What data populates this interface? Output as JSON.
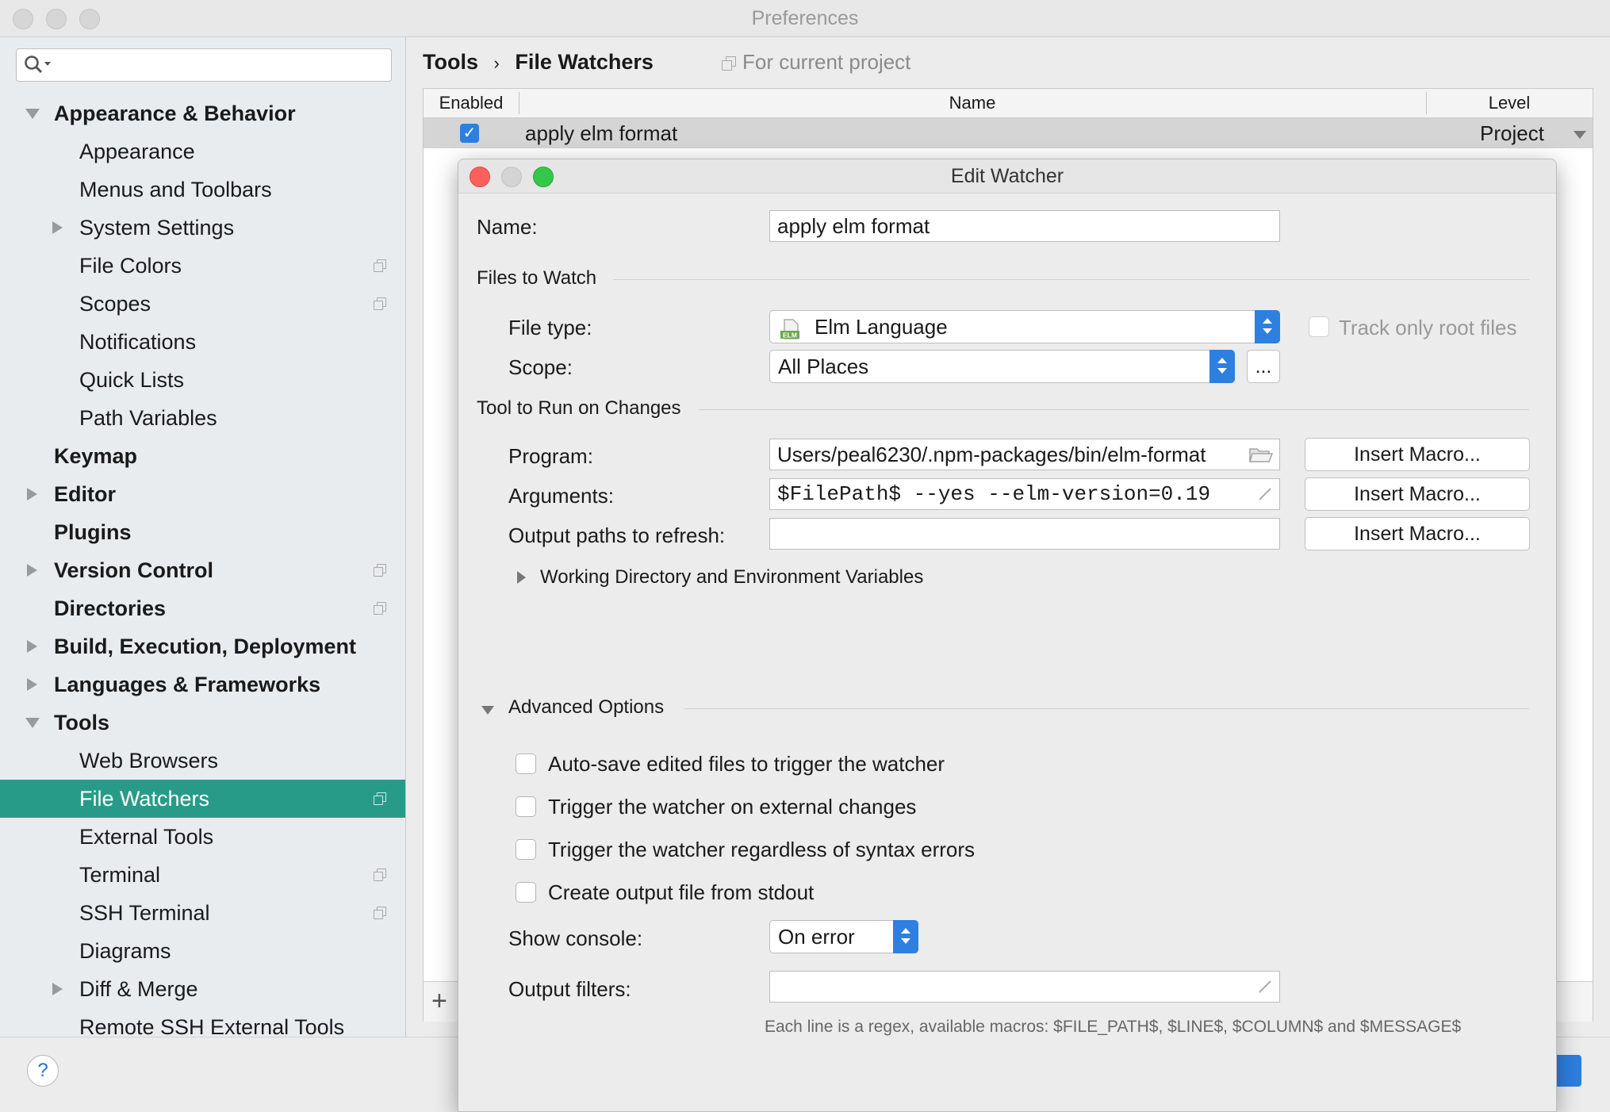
{
  "preferences": {
    "window_title": "Preferences",
    "breadcrumb": {
      "parent": "Tools",
      "separator": "›",
      "current": "File Watchers"
    },
    "scope_note": "For current project"
  },
  "sidebar": {
    "search_placeholder": "",
    "items": [
      {
        "label": "Appearance & Behavior",
        "level": 0,
        "bold": true,
        "expander": "expanded"
      },
      {
        "label": "Appearance",
        "level": 1
      },
      {
        "label": "Menus and Toolbars",
        "level": 1
      },
      {
        "label": "System Settings",
        "level": 1,
        "expander": "collapsed"
      },
      {
        "label": "File Colors",
        "level": 1,
        "project_icon": true
      },
      {
        "label": "Scopes",
        "level": 1,
        "project_icon": true
      },
      {
        "label": "Notifications",
        "level": 1
      },
      {
        "label": "Quick Lists",
        "level": 1
      },
      {
        "label": "Path Variables",
        "level": 1
      },
      {
        "label": "Keymap",
        "level": 0,
        "bold": true
      },
      {
        "label": "Editor",
        "level": 0,
        "bold": true,
        "expander": "collapsed"
      },
      {
        "label": "Plugins",
        "level": 0,
        "bold": true
      },
      {
        "label": "Version Control",
        "level": 0,
        "bold": true,
        "expander": "collapsed",
        "project_icon": true
      },
      {
        "label": "Directories",
        "level": 0,
        "bold": true,
        "project_icon": true
      },
      {
        "label": "Build, Execution, Deployment",
        "level": 0,
        "bold": true,
        "expander": "collapsed"
      },
      {
        "label": "Languages & Frameworks",
        "level": 0,
        "bold": true,
        "expander": "collapsed"
      },
      {
        "label": "Tools",
        "level": 0,
        "bold": true,
        "expander": "expanded"
      },
      {
        "label": "Web Browsers",
        "level": 1
      },
      {
        "label": "File Watchers",
        "level": 1,
        "selected": true,
        "project_icon": true
      },
      {
        "label": "External Tools",
        "level": 1
      },
      {
        "label": "Terminal",
        "level": 1,
        "project_icon": true
      },
      {
        "label": "SSH Terminal",
        "level": 1,
        "project_icon": true
      },
      {
        "label": "Diagrams",
        "level": 1
      },
      {
        "label": "Diff & Merge",
        "level": 1,
        "expander": "collapsed"
      },
      {
        "label": "Remote SSH External Tools",
        "level": 1
      }
    ]
  },
  "table": {
    "headers": [
      "Enabled",
      "Name",
      "Level"
    ],
    "rows": [
      {
        "enabled": true,
        "name": "apply elm format",
        "level": "Project"
      }
    ],
    "add_label": "+"
  },
  "help_label": "?",
  "dialog": {
    "title": "Edit Watcher",
    "name_label": "Name:",
    "name_value": "apply elm format",
    "files_section": "Files to Watch",
    "file_type_label": "File type:",
    "file_type_value": "Elm Language",
    "file_type_icon_text": "ELM",
    "track_root_label": "Track only root files",
    "scope_label": "Scope:",
    "scope_value": "All Places",
    "scope_more": "...",
    "tool_section": "Tool to Run on Changes",
    "program_label": "Program:",
    "program_value": "Users/peal6230/.npm-packages/bin/elm-format",
    "arguments_label": "Arguments:",
    "arguments_value": "$FilePath$ --yes --elm-version=0.19",
    "output_paths_label": "Output paths to refresh:",
    "output_paths_value": "",
    "insert_macro_label": "Insert Macro...",
    "working_dir_label": "Working Directory and Environment Variables",
    "advanced_section": "Advanced Options",
    "options": [
      {
        "label": "Auto-save edited files to trigger the watcher",
        "checked": false
      },
      {
        "label": "Trigger the watcher on external changes",
        "checked": false
      },
      {
        "label": "Trigger the watcher regardless of syntax errors",
        "checked": false
      },
      {
        "label": "Create output file from stdout",
        "checked": false
      }
    ],
    "show_console_label": "Show console:",
    "show_console_value": "On error",
    "output_filters_label": "Output filters:",
    "output_filters_value": "",
    "hint": "Each line is a regex, available macros: $FILE_PATH$, $LINE$, $COLUMN$ and $MESSAGE$"
  },
  "colors": {
    "selection": "#289b88",
    "accent_blue": "#2d7fe0",
    "close": "#fc605c",
    "minimize": "#fdbc40",
    "zoom": "#34c84a"
  }
}
